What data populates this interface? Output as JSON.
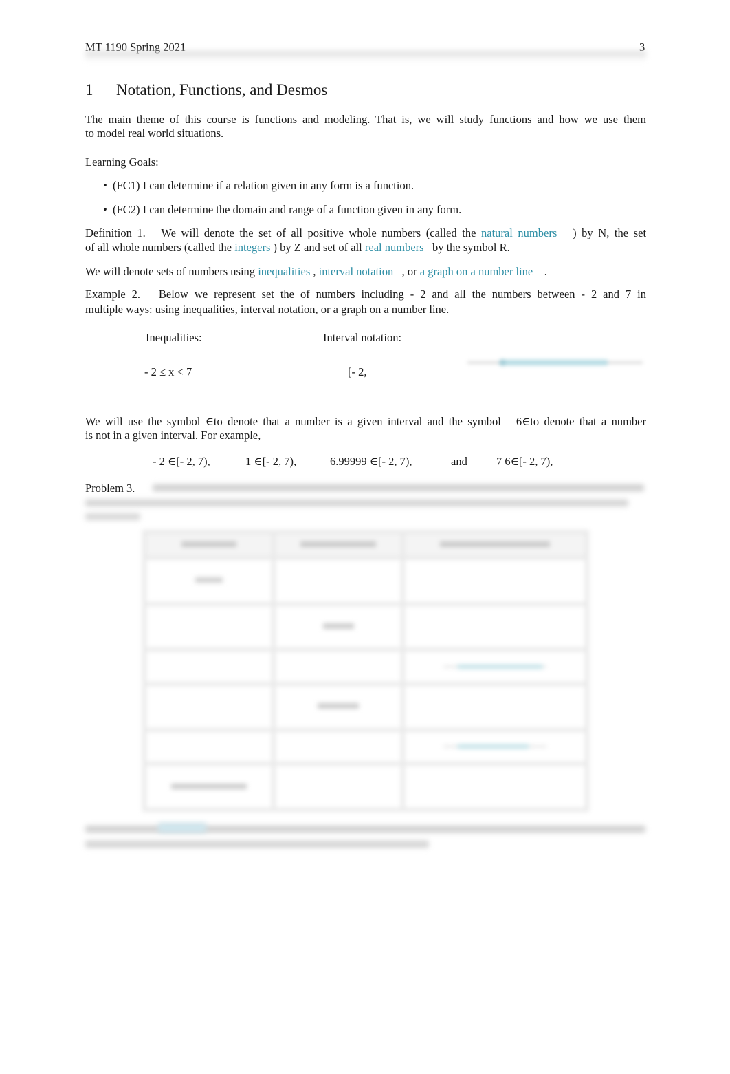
{
  "header": {
    "course": "MT 1190 Spring 2021",
    "page_number": "3"
  },
  "section": {
    "number": "1",
    "title": "Notation, Functions, and Desmos"
  },
  "intro": {
    "before": "The main theme of this course is ",
    "emphasis": "functions and modeling",
    "after": ". That is, we will study functions and how we use them",
    "line2": "to model real world situations."
  },
  "learning_goals": {
    "label": "Learning Goals:",
    "items": [
      "(FC1) I can determine if a relation given in any form is a function.",
      "(FC2) I can determine the domain and range of a function given in any form."
    ]
  },
  "definition": {
    "label": "Definition 1.",
    "line1_a": "We will denote the set of all positive whole numbers (called the",
    "link_natural": "natural numbers",
    "line1_b": ") by N, the set",
    "line2_a": "of all whole numbers (called the",
    "link_integers": "integers",
    "line2_b": ") by Z  and set of all",
    "link_real": "real numbers",
    "line2_c": "by the symbol R."
  },
  "denote": {
    "a": "We will denote sets of numbers using",
    "link1": "inequalities",
    "sep1": ",",
    "link2": "interval notation",
    "sep2": ", or",
    "link3": "a graph on a number line",
    "end": "."
  },
  "example": {
    "label": "Example 2.",
    "line1": "Below we represent set the of numbers including  - 2 and all the numbers between  - 2 and 7 in",
    "line2": "multiple ways: using inequalities, interval notation, or a graph on a number line.",
    "col1_label": "Inequalities:",
    "col2_label": "Interval notation:",
    "inequality": "- 2 ≤  x <  7",
    "interval": "[- 2,",
    "graph": {
      "from": -2,
      "to": 7,
      "left_closed": true,
      "right_closed": false
    }
  },
  "membership": {
    "line1_a": "We will use the symbol",
    "in_symbol": "∈",
    "line1_b": "to denote that a number is a given interval and the symbol",
    "notin_symbol": "6∈",
    "line1_c": "to denote that a number",
    "line2": "is not in a given interval. For example,",
    "examples": [
      "- 2 ∈[- 2, 7),",
      "1 ∈[- 2, 7),",
      "6.99999 ∈[- 2, 7),",
      "and",
      "7 6∈[- 2, 7),"
    ]
  },
  "problem": {
    "label": "Problem 3.",
    "obscured_text": true,
    "table": {
      "headers": [
        "",
        "",
        ""
      ],
      "rows": [
        [
          "",
          "",
          ""
        ],
        [
          "",
          "",
          ""
        ],
        [
          "",
          "",
          "graph"
        ],
        [
          "",
          "",
          ""
        ],
        [
          "",
          "",
          "graph"
        ],
        [
          "",
          "",
          ""
        ]
      ]
    }
  },
  "colors": {
    "link": "#2f8fa6",
    "text": "#1a1a1a"
  }
}
